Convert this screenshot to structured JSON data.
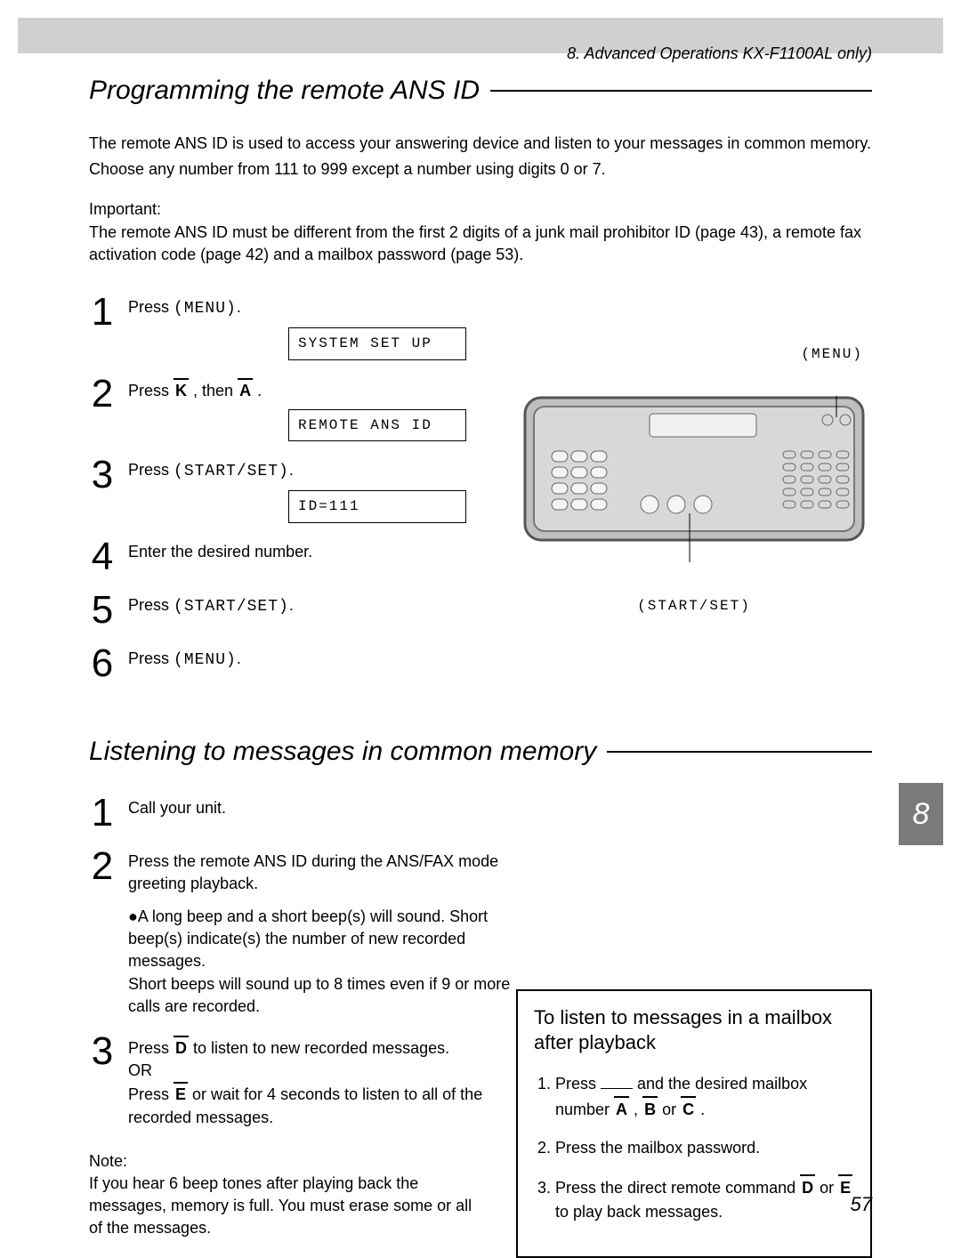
{
  "chapterHeader": "8. Advanced Operations KX-F1100AL only)",
  "sectionA": {
    "title": "Programming the remote ANS ID",
    "intro1": "The remote ANS ID is used to access your answering device and listen to your messages in common memory.",
    "intro2": "Choose any number from 111 to 999 except a number using digits 0 or 7.",
    "importantLabel": "Important:",
    "importantText": "The remote ANS ID must be different from the ﬁrst 2 digits of a junk mail prohibitor ID (page 43), a remote fax activation code (page 42) and a mailbox password (page 53).",
    "steps": {
      "s1": {
        "num": "1",
        "textA": "Press ",
        "code": "(MENU)",
        "textB": "."
      },
      "s1disp": "SYSTEM SET UP",
      "s2": {
        "num": "2",
        "textA": "Press ",
        "k1": "K",
        "mid": " , then ",
        "k2": "A",
        "end": " ."
      },
      "s2disp": "REMOTE ANS ID",
      "s3": {
        "num": "3",
        "textA": "Press ",
        "code": "(START/SET)",
        "textB": "."
      },
      "s3disp": "ID=111",
      "s4": {
        "num": "4",
        "text": "Enter the desired number."
      },
      "s5": {
        "num": "5",
        "textA": "Press ",
        "code": "(START/SET)",
        "textB": "."
      },
      "s6": {
        "num": "6",
        "textA": "Press ",
        "code": "(MENU)",
        "textB": "."
      }
    },
    "labelMenu": "(MENU)",
    "labelStartSet": "(START/SET)"
  },
  "sectionB": {
    "title": "Listening to messages in common memory",
    "steps": {
      "s1": {
        "num": "1",
        "text": "Call your unit."
      },
      "s2": {
        "num": "2",
        "text": "Press the remote ANS ID during the ANS/FAX mode greeting playback."
      },
      "s2bullet1": "●A long beep and a short beep(s) will sound. Short beep(s) indicate(s) the number of new recorded messages.",
      "s2bullet2": "Short beeps will sound up to 8 times even if 9 or more calls are recorded.",
      "s3": {
        "num": "3",
        "a1": "Press ",
        "kD": "D",
        "a2": "  to listen to new recorded messages.",
        "or": "OR",
        "b1": "Press ",
        "kE": "E",
        "b2": "  or wait for 4 seconds to listen to all of the recorded messages."
      }
    },
    "noteLabel": "Note:",
    "noteText": "If you hear 6 beep tones after playing back the messages, memory is full. You must erase some or all of the messages."
  },
  "sideBox": {
    "title": "To listen to messages in a mailbox after playback",
    "li1a": "Press ",
    "li1b": " and the desired mailbox number ",
    "kA": "A",
    "kB": "B",
    "kC": "C",
    "kOr": " or ",
    "comma": " , ",
    "dot": " .",
    "li2": "Press the mailbox password.",
    "li3a": "Press the direct remote command ",
    "kD": "D",
    "li3mid": " or ",
    "kE": "E",
    "li3b": "  to play back messages."
  },
  "chapterTab": "8",
  "pageNum": "57"
}
